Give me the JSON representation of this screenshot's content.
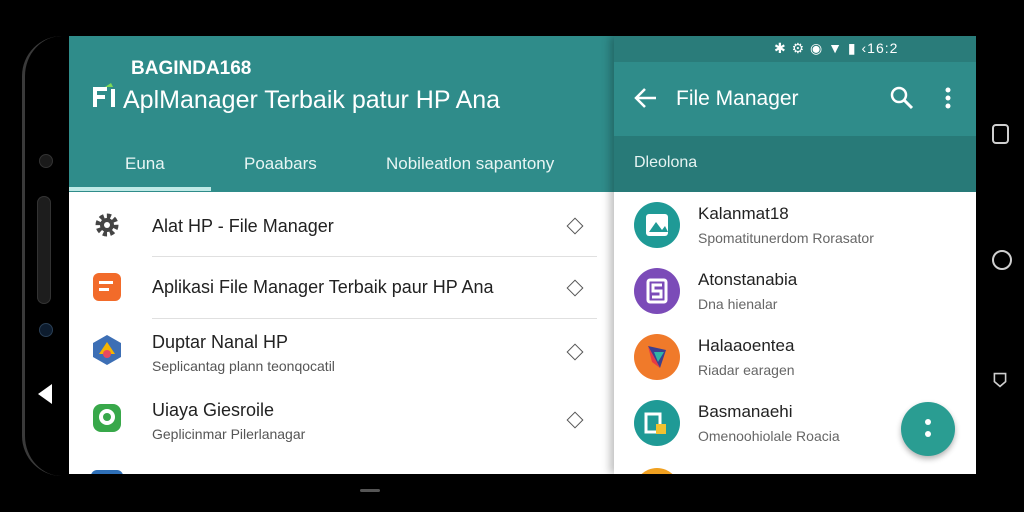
{
  "left": {
    "brand": "BAGINDA168",
    "title": "AplManager Terbaik patur HP Ana",
    "tabs": [
      "Euna",
      "Poaabars",
      "Nobileatlon sapantony"
    ],
    "items": [
      {
        "title": "Alat HP - File Manager",
        "subtitle": "",
        "icon": "gear-icon"
      },
      {
        "title": "Aplikasi File Manager Terbaik paur HP Ana",
        "subtitle": "",
        "icon": "orange-app-icon"
      },
      {
        "title": "Duptar Nanal HP",
        "subtitle": "Seplicantag plann teonqocatil",
        "icon": "hexagon-app-icon"
      },
      {
        "title": "Uiaya Giesroile",
        "subtitle": "Geplicinmar Pilerlanagar",
        "icon": "chat-app-icon"
      }
    ]
  },
  "right": {
    "status_text": "✱ ⚙ ◉ ▼ ▮ ‹16:2",
    "appbar_title": "File Manager",
    "section_label": "Dleolona",
    "items": [
      {
        "title": "Kalanmat18",
        "subtitle": "Spomatitunerdom Rorasator",
        "color": "#1f9a96",
        "icon": "image-app-icon"
      },
      {
        "title": "Atonstanabia",
        "subtitle": "Dna hienalar",
        "color": "#7b4bb8",
        "icon": "s-app-icon"
      },
      {
        "title": "Halaaoentea",
        "subtitle": "Riadar earagen",
        "color": "#f07a2a",
        "icon": "kite-app-icon"
      },
      {
        "title": "Basmanaehi",
        "subtitle": "Omenoohiolale Roacia",
        "color": "#1f9a96",
        "icon": "folder-app-icon"
      }
    ]
  },
  "colors": {
    "primary": "#2f8c8a",
    "primary_dark": "#287a78",
    "fab": "#2a9d92"
  }
}
